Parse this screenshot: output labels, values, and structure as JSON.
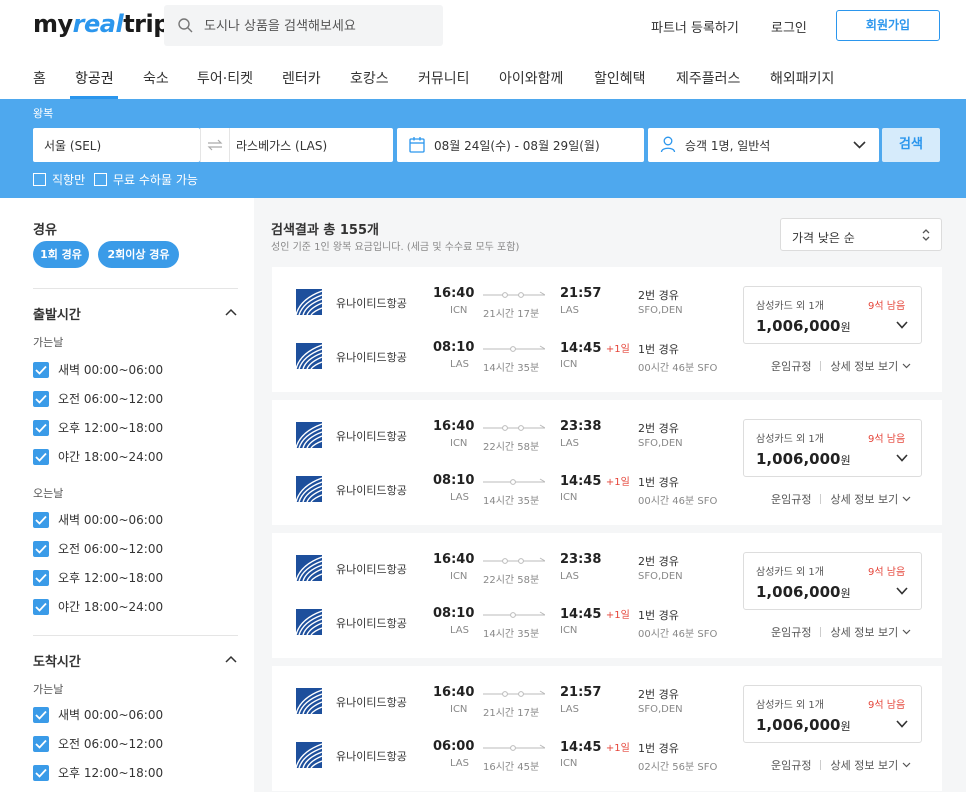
{
  "header": {
    "logo_prefix": "my",
    "logo_accent": "real",
    "logo_suffix": "trip",
    "search_placeholder": "도시나 상품을 검색해보세요",
    "partner_link": "파트너 등록하기",
    "login_link": "로그인",
    "signup_button": "회원가입"
  },
  "nav": {
    "items": [
      "홈",
      "항공권",
      "숙소",
      "투어·티켓",
      "렌터카",
      "호캉스",
      "커뮤니티",
      "아이와함께",
      "할인혜택",
      "제주플러스",
      "해외패키지"
    ],
    "active": "항공권"
  },
  "search_form": {
    "trip_type": "왕복",
    "origin": "서울 (SEL)",
    "destination": "라스베가스 (LAS)",
    "dates": "08월 24일(수)  -  08월 29일(월)",
    "passengers": "승객 1명, 일반석",
    "search_button": "검색",
    "option_direct": "직항만",
    "option_free_baggage": "무료 수하물 가능"
  },
  "filters": {
    "stopover_title": "경유",
    "stopover_pills": [
      "1회 경유",
      "2회이상 경유"
    ],
    "departure_title": "출발시간",
    "arrival_title": "도착시간",
    "outbound_label": "가는날",
    "return_label": "오는날",
    "time_slots": [
      "새벽 00:00~06:00",
      "오전 06:00~12:00",
      "오후 12:00~18:00",
      "야간 18:00~24:00"
    ]
  },
  "results": {
    "title": "검색결과 총 155개",
    "subtitle": "성인 기준 1인 왕복 요금입니다. (세금 및 수수료 모두 포함)",
    "sort_label": "가격 낮은 순",
    "fare_rules_link": "운임규정",
    "details_link": "상세 정보 보기",
    "cards": [
      {
        "outbound": {
          "airline": "유나이티드항공",
          "dep": "16:40",
          "dep_code": "ICN",
          "arr": "21:57",
          "arr_code": "LAS",
          "duration": "21시간 17분",
          "plus": "",
          "stops": "2번 경유",
          "via": "SFO,DEN"
        },
        "inbound": {
          "airline": "유나이티드항공",
          "dep": "08:10",
          "dep_code": "LAS",
          "arr": "14:45",
          "arr_code": "ICN",
          "duration": "14시간 35분",
          "plus": "+1일",
          "stops": "1번 경유",
          "via": "00시간 46분 SFO"
        },
        "card_promo": "삼성카드 외 1개",
        "seats": "9석 남음",
        "price": "1,006,000",
        "currency": "원"
      },
      {
        "outbound": {
          "airline": "유나이티드항공",
          "dep": "16:40",
          "dep_code": "ICN",
          "arr": "23:38",
          "arr_code": "LAS",
          "duration": "22시간 58분",
          "plus": "",
          "stops": "2번 경유",
          "via": "SFO,DEN"
        },
        "inbound": {
          "airline": "유나이티드항공",
          "dep": "08:10",
          "dep_code": "LAS",
          "arr": "14:45",
          "arr_code": "ICN",
          "duration": "14시간 35분",
          "plus": "+1일",
          "stops": "1번 경유",
          "via": "00시간 46분 SFO"
        },
        "card_promo": "삼성카드 외 1개",
        "seats": "9석 남음",
        "price": "1,006,000",
        "currency": "원"
      },
      {
        "outbound": {
          "airline": "유나이티드항공",
          "dep": "16:40",
          "dep_code": "ICN",
          "arr": "23:38",
          "arr_code": "LAS",
          "duration": "22시간 58분",
          "plus": "",
          "stops": "2번 경유",
          "via": "SFO,DEN"
        },
        "inbound": {
          "airline": "유나이티드항공",
          "dep": "08:10",
          "dep_code": "LAS",
          "arr": "14:45",
          "arr_code": "ICN",
          "duration": "14시간 35분",
          "plus": "+1일",
          "stops": "1번 경유",
          "via": "00시간 46분 SFO"
        },
        "card_promo": "삼성카드 외 1개",
        "seats": "9석 남음",
        "price": "1,006,000",
        "currency": "원"
      },
      {
        "outbound": {
          "airline": "유나이티드항공",
          "dep": "16:40",
          "dep_code": "ICN",
          "arr": "21:57",
          "arr_code": "LAS",
          "duration": "21시간 17분",
          "plus": "",
          "stops": "2번 경유",
          "via": "SFO,DEN"
        },
        "inbound": {
          "airline": "유나이티드항공",
          "dep": "06:00",
          "dep_code": "LAS",
          "arr": "14:45",
          "arr_code": "ICN",
          "duration": "16시간 45분",
          "plus": "+1일",
          "stops": "1번 경유",
          "via": "02시간 56분 SFO"
        },
        "card_promo": "삼성카드 외 1개",
        "seats": "9석 남음",
        "price": "1,006,000",
        "currency": "원"
      }
    ]
  },
  "colors": {
    "brand_blue": "#2b96ed",
    "search_band": "#4ea8ee",
    "checkbox_blue": "#3a9be8",
    "alert_red": "#e5453a",
    "airline_navy": "#1d4f9c"
  }
}
